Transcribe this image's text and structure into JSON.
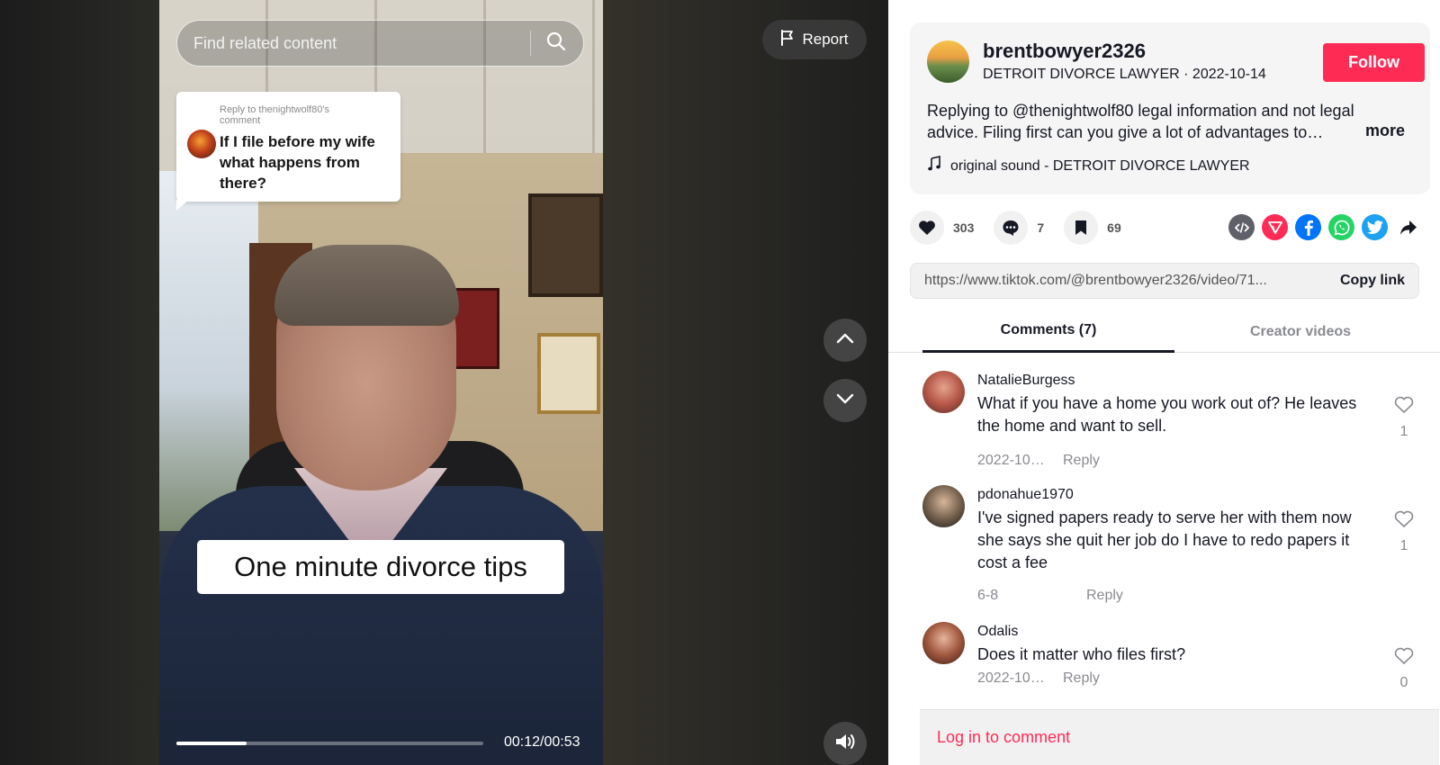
{
  "search": {
    "placeholder": "Find related content"
  },
  "report": {
    "label": "Report"
  },
  "reply_card": {
    "meta": "Reply to thenightwolf80's comment",
    "question": "If I file before my wife what happens from there?"
  },
  "caption": "One minute divorce tips",
  "player": {
    "time": "00:12/00:53",
    "progress": 0.23
  },
  "author": {
    "username": "brentbowyer2326",
    "subline": "DETROIT DIVORCE LAWYER · 2022-10-14",
    "follow_label": "Follow",
    "description": "Replying to @thenightwolf80 legal information and not legal advice. Filing first can you give a lot of advantages to…",
    "more_label": "more",
    "sound": "original sound - DETROIT DIVORCE LAWYER"
  },
  "stats": {
    "likes": "303",
    "comments": "7",
    "saves": "69"
  },
  "share_icons": [
    "embed-icon",
    "send-icon",
    "facebook-icon",
    "whatsapp-icon",
    "twitter-icon",
    "share-arrow-icon"
  ],
  "colors": {
    "accent": "#fe2c55",
    "embed": "#5f6069",
    "send": "#fe2c55",
    "facebook": "#0075fa",
    "whatsapp": "#25d366",
    "twitter": "#1da1f2"
  },
  "link": {
    "url": "https://www.tiktok.com/@brentbowyer2326/video/71...",
    "copy_label": "Copy link"
  },
  "tabs": [
    {
      "label": "Comments (7)",
      "active": true
    },
    {
      "label": "Creator videos",
      "active": false
    }
  ],
  "comments": [
    {
      "user": "NatalieBurgess",
      "text": "What if you have a home you work out of? He leaves the home and want to sell.",
      "date": "2022-10…",
      "reply": "Reply",
      "likes": "1"
    },
    {
      "user": "pdonahue1970",
      "text": "I've signed papers ready to serve her with them now she says she quit her job do I have to redo papers it cost a fee",
      "date": "6-8",
      "reply": "Reply",
      "likes": "1"
    },
    {
      "user": "Odalis",
      "text": "Does it matter who files first?",
      "date": "2022-10…",
      "reply": "Reply",
      "likes": "0"
    }
  ],
  "login": {
    "label": "Log in to comment"
  }
}
